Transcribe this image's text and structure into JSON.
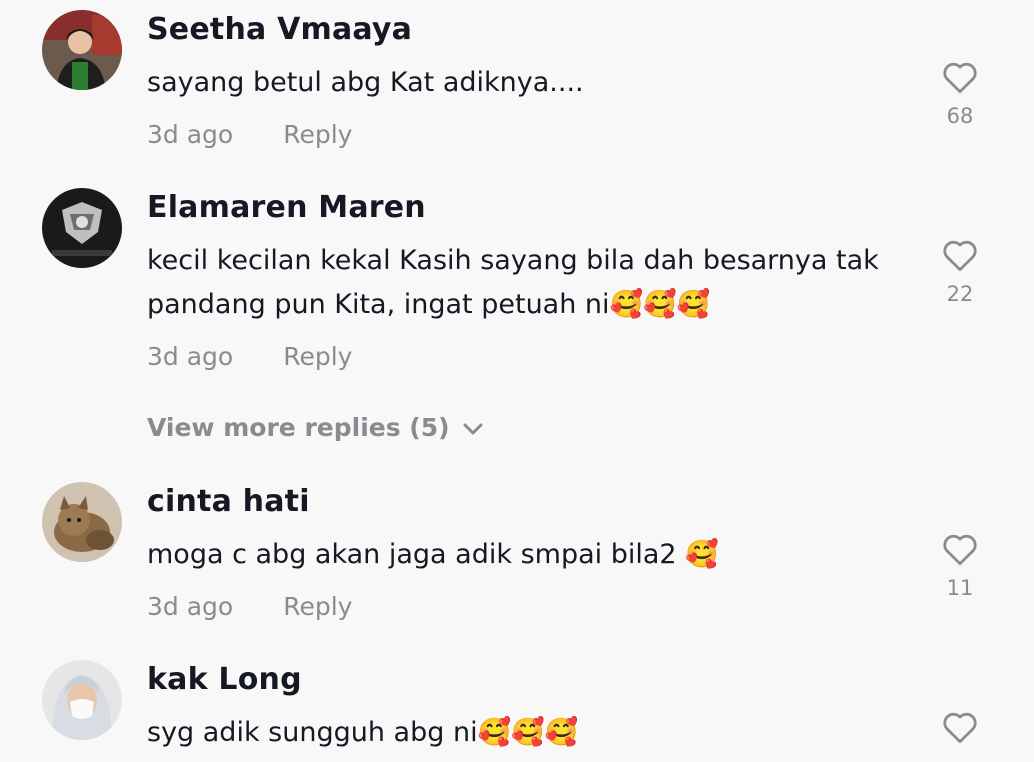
{
  "comments": [
    {
      "username": "Seetha Vmaaya",
      "text": "sayang betul abg Kat adiknya....",
      "time": "3d ago",
      "reply_label": "Reply",
      "likes": "68",
      "avatar_icon": "user-photo-avatar"
    },
    {
      "username": "Elamaren Maren",
      "text": "kecil kecilan kekal Kasih sayang bila dah besarnya tak pandang pun Kita, ingat petuah ni🥰🥰🥰",
      "time": "3d ago",
      "reply_label": "Reply",
      "likes": "22",
      "avatar_icon": "emblem-avatar"
    },
    {
      "username": "cinta hati",
      "text": "moga c abg akan jaga adik smpai bila2 🥰",
      "time": "3d ago",
      "reply_label": "Reply",
      "likes": "11",
      "avatar_icon": "cat-photo-avatar"
    },
    {
      "username": "kak Long",
      "text": "syg adik sungguh abg ni🥰🥰🥰",
      "time": "",
      "reply_label": "",
      "likes": "",
      "avatar_icon": "user-photo-avatar"
    }
  ],
  "view_more_replies": "View more replies (5)",
  "colors": {
    "background": "#f8f8f8",
    "primary_text": "#161823",
    "secondary_text": "#8a8b91"
  }
}
